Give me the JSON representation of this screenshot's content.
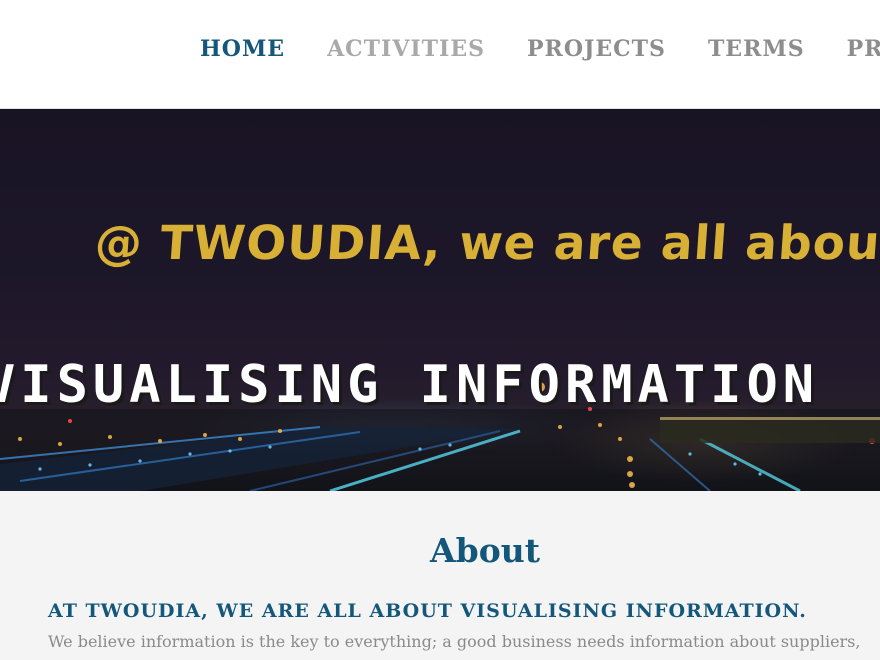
{
  "nav": {
    "items": [
      {
        "label": "HOME",
        "state": "active"
      },
      {
        "label": "ACTIVITIES",
        "state": "faint"
      },
      {
        "label": "PROJECTS",
        "state": "normal"
      },
      {
        "label": "TERMS",
        "state": "normal"
      },
      {
        "label": "PRIVACY",
        "state": "normal"
      }
    ]
  },
  "hero": {
    "tagline": "@ TWOUDIA, we are all about",
    "headline": "VISUALISING INFORMATION"
  },
  "about": {
    "title": "About",
    "subtitle": "AT TWOUDIA, WE ARE ALL ABOUT VISUALISING INFORMATION.",
    "body": "We believe information is the key to everything; a good business needs information about suppliers,"
  },
  "colors": {
    "brand_blue": "#13577a",
    "nav_gray": "#8d8d8d",
    "tagline_gold": "#d7b035",
    "body_gray": "#8a8a8a"
  }
}
